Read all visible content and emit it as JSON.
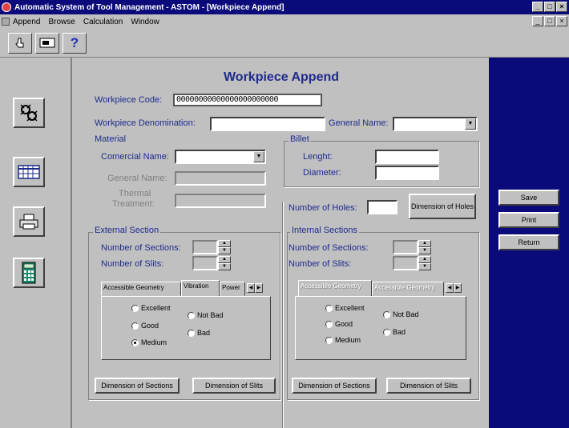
{
  "window": {
    "title": "Automatic System of Tool Management - ASTOM - [Workpiece Append]",
    "title_buttons": [
      "_",
      "□",
      "×"
    ],
    "mdi_buttons": [
      "_",
      "□",
      "×"
    ]
  },
  "menu": [
    "Append",
    "Browse",
    "Calculation",
    "Window"
  ],
  "toolbar": {
    "help_glyph": "?"
  },
  "form": {
    "heading": "Workpiece Append",
    "code_label": "Workpiece Code:",
    "code_value": "00000000000000000000000",
    "denomination_label": "Workpiece Denomination:",
    "general_name_label": "General Name:",
    "material": {
      "title": "Material",
      "comercial_name_label": "Comercial Name:",
      "general_name_label": "General Name:",
      "thermal_label_1": "Thermal",
      "thermal_label_2": "Treatment:"
    },
    "billet": {
      "title": "Billet",
      "lenght_label": "Lenght:",
      "diameter_label": "Diameter:"
    },
    "holes": {
      "label": "Number of Holes:",
      "button": "Dimension of Holes"
    },
    "external": {
      "title": "External Section",
      "sections_label": "Number of Sections:",
      "slits_label": "Number of Slits:",
      "tabs": [
        "Accessible Geometry",
        "Vibration",
        "Power"
      ],
      "radios": [
        "Excellent",
        "Good",
        "Medium",
        "Not Bad",
        "Bad"
      ],
      "selected": "Medium",
      "btn_sections": "Dimension of Sections",
      "btn_slits": "Dimension of Slits"
    },
    "internal": {
      "title": "Internal Sections",
      "sections_label": "Number of Sections:",
      "slits_label": "Number of Slits:",
      "tabs": [
        "Accessible Geometry",
        "Accessible Geometry"
      ],
      "radios": [
        "Excellent",
        "Good",
        "Medium",
        "Not Bad",
        "Bad"
      ],
      "btn_sections": "Dimension of Sections",
      "btn_slits": "Dimension of Slits"
    }
  },
  "actions": {
    "save": "Save",
    "print": "Print",
    "return": "Return"
  },
  "colors": {
    "label_text": "#1e2a8c",
    "title_bar": "#0a0a7a",
    "right_panel": "#0a0a7a",
    "face": "#c0c0c0"
  }
}
